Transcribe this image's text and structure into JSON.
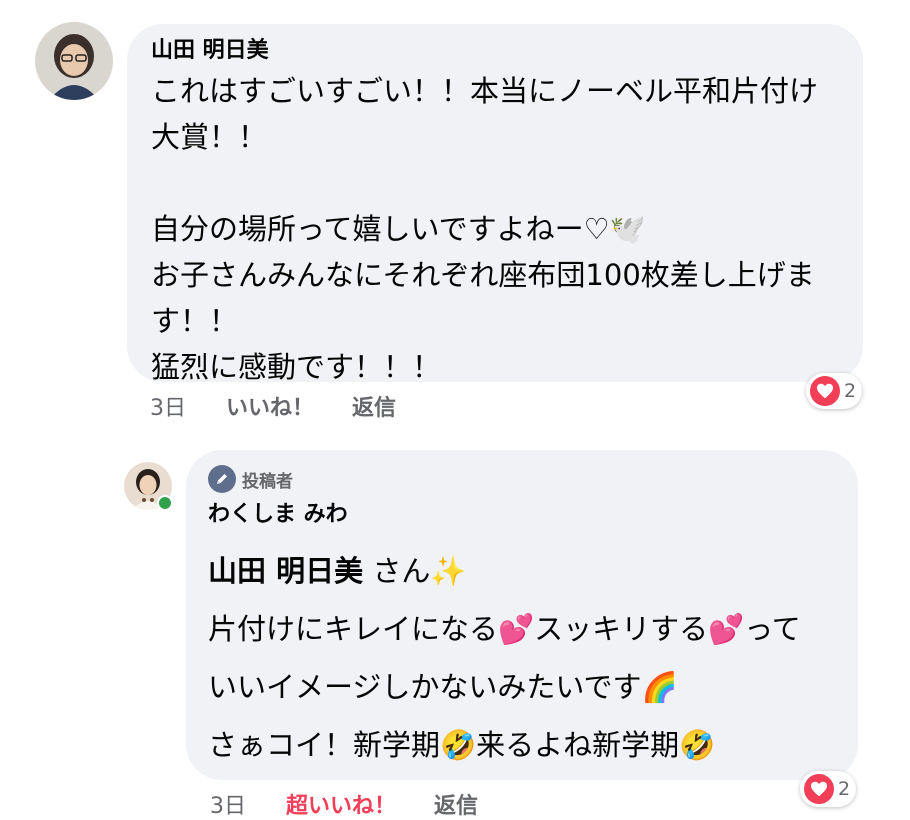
{
  "comment1": {
    "author": "山田 明日美",
    "lines": [
      "これはすごいすごい！！本当にノーベル平和片付け",
      "大賞！！",
      "",
      "自分の場所って嬉しいですよねー♡🕊️",
      "お子さんみんなにそれぞれ座布団100枚差し上げま",
      "す！！",
      "猛烈に感動です！！！"
    ],
    "time": "3日",
    "like_label": "いいね！",
    "reply_label": "返信",
    "reaction_count": "2"
  },
  "comment2": {
    "badge": "投稿者",
    "author": "わくしま みわ",
    "mention": "山田 明日美",
    "mention_suffix": " さん✨",
    "lines": [
      "片付けにキレイになる💕スッキリする💕って",
      "いいイメージしかないみたいです🌈",
      "さぁコイ！新学期🤣来るよね新学期🤣"
    ],
    "time": "3日",
    "like_label": "超いいね！",
    "reply_label": "返信",
    "reaction_count": "2"
  },
  "colors": {
    "bubble": "#f0f2f5",
    "love": "#f33e58",
    "meta_text": "#65676b",
    "online": "#31a24c"
  }
}
